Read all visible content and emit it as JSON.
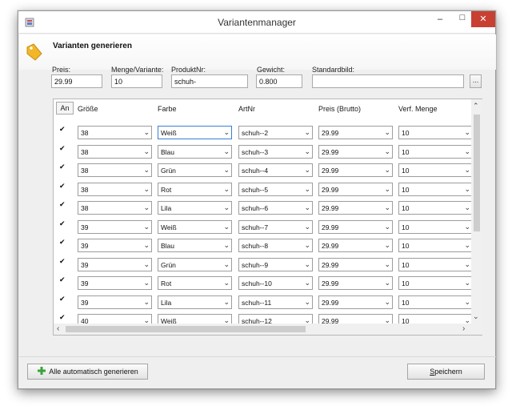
{
  "window": {
    "title": "Variantenmanager",
    "minimize": "–",
    "maximize": "□",
    "close": "✕"
  },
  "header": {
    "title": "Varianten generieren"
  },
  "form": {
    "preis_label": "Preis:",
    "preis_value": "29.99",
    "menge_label": "Menge/Variante:",
    "menge_value": "10",
    "produktnr_label": "ProduktNr:",
    "produktnr_value": "schuh-",
    "gewicht_label": "Gewicht:",
    "gewicht_value": "0.800",
    "standardbild_label": "Standardbild:",
    "standardbild_value": "",
    "browse_label": "..."
  },
  "grid": {
    "headers": {
      "an": "An",
      "groesse": "Größe",
      "farbe": "Farbe",
      "artnr": "ArtNr",
      "preis": "Preis (Brutto)",
      "menge": "Verf. Menge"
    },
    "rows": [
      {
        "checked": true,
        "groesse": "38",
        "farbe": "Weiß",
        "artnr": "schuh--2",
        "preis": "29.99",
        "menge": "10"
      },
      {
        "checked": true,
        "groesse": "38",
        "farbe": "Blau",
        "artnr": "schuh--3",
        "preis": "29.99",
        "menge": "10"
      },
      {
        "checked": true,
        "groesse": "38",
        "farbe": "Grün",
        "artnr": "schuh--4",
        "preis": "29.99",
        "menge": "10"
      },
      {
        "checked": true,
        "groesse": "38",
        "farbe": "Rot",
        "artnr": "schuh--5",
        "preis": "29.99",
        "menge": "10"
      },
      {
        "checked": true,
        "groesse": "38",
        "farbe": "Lila",
        "artnr": "schuh--6",
        "preis": "29.99",
        "menge": "10"
      },
      {
        "checked": true,
        "groesse": "39",
        "farbe": "Weiß",
        "artnr": "schuh--7",
        "preis": "29.99",
        "menge": "10"
      },
      {
        "checked": true,
        "groesse": "39",
        "farbe": "Blau",
        "artnr": "schuh--8",
        "preis": "29.99",
        "menge": "10"
      },
      {
        "checked": true,
        "groesse": "39",
        "farbe": "Grün",
        "artnr": "schuh--9",
        "preis": "29.99",
        "menge": "10"
      },
      {
        "checked": true,
        "groesse": "39",
        "farbe": "Rot",
        "artnr": "schuh--10",
        "preis": "29.99",
        "menge": "10"
      },
      {
        "checked": true,
        "groesse": "39",
        "farbe": "Lila",
        "artnr": "schuh--11",
        "preis": "29.99",
        "menge": "10"
      },
      {
        "checked": true,
        "groesse": "40",
        "farbe": "Weiß",
        "artnr": "schuh--12",
        "preis": "29.99",
        "menge": "10"
      }
    ],
    "check_glyph": "✔",
    "dropdown_glyph": "⌄"
  },
  "footer": {
    "generate_label": "Alle automatisch generieren",
    "save_prefix": "S",
    "save_rest": "peichern"
  },
  "colors": {
    "close_button": "#c84031",
    "focus_border": "#3c7fd0",
    "tag_icon": "#f2b62b",
    "plus_icon": "#3ba33b"
  }
}
